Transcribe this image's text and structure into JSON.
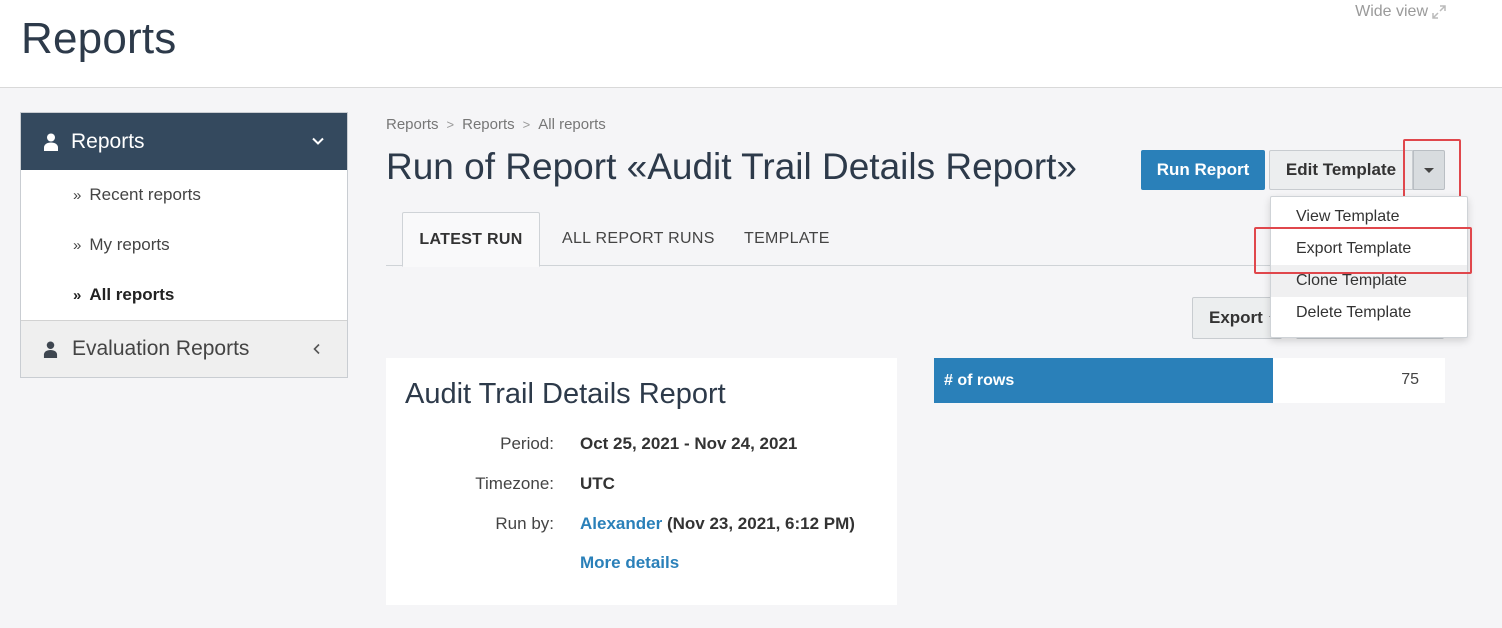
{
  "header": {
    "title": "Reports",
    "wide_view": "Wide view"
  },
  "sidebar": {
    "section_title": "Reports",
    "items": [
      {
        "label": "Recent reports"
      },
      {
        "label": "My reports"
      },
      {
        "label": "All reports"
      }
    ],
    "eval_title": "Evaluation Reports"
  },
  "breadcrumb": [
    "Reports",
    "Reports",
    "All reports"
  ],
  "main": {
    "title": "Run of Report «Audit Trail Details Report»",
    "run_button": "Run Report",
    "edit_button": "Edit Template",
    "tabs": [
      {
        "label": "LATEST RUN"
      },
      {
        "label": "ALL REPORT RUNS"
      },
      {
        "label": "TEMPLATE"
      }
    ],
    "export_button": "Export",
    "dropdown": [
      {
        "label": "View Template"
      },
      {
        "label": "Export Template"
      },
      {
        "label": "Clone Template"
      },
      {
        "label": "Delete Template"
      }
    ]
  },
  "report": {
    "title": "Audit Trail Details Report",
    "period_label": "Period:",
    "period_value": "Oct 25, 2021 - Nov 24, 2021",
    "timezone_label": "Timezone:",
    "timezone_value": "UTC",
    "runby_label": "Run by:",
    "runby_user": "Alexander",
    "runby_time": "(Nov 23, 2021, 6:12 PM)",
    "more_details": "More details"
  },
  "stats": {
    "rows_label": "# of rows",
    "rows_value": "75"
  },
  "colors": {
    "nav_dark": "#34495e",
    "accent_blue": "#2a80b9",
    "highlight_red": "#e0474c"
  }
}
